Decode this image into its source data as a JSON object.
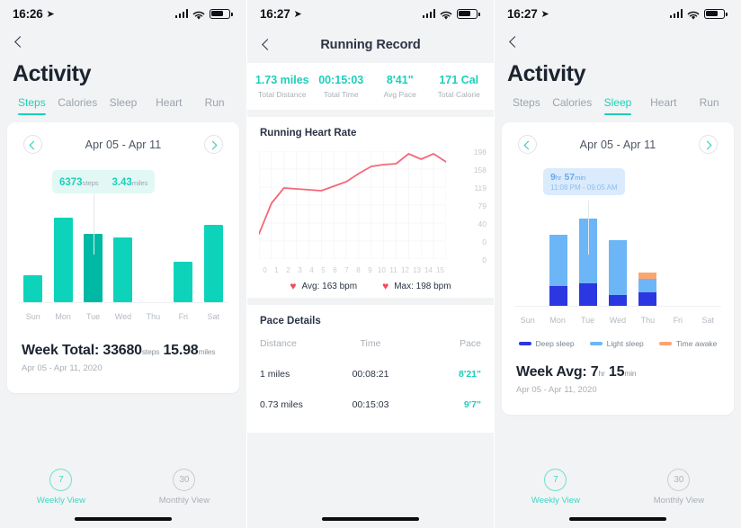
{
  "theme": {
    "accent_teal": "#1ecfbb",
    "bar_teal": "#0ed3bb",
    "bar_teal_highlight": "#00b9a5",
    "deep_sleep": "#2b37e0",
    "light_sleep": "#6cb6f7",
    "time_awake": "#fba570",
    "heart_red": "#f5495c",
    "page_bg": "#f2f3f4"
  },
  "panel_steps": {
    "status": {
      "time": "16:26",
      "location_icon": "location-arrow-icon",
      "signal_icon": "cellular-signal-icon",
      "wifi_icon": "wifi-icon",
      "battery_icon": "battery-icon"
    },
    "back_icon": "back-chevron-icon",
    "page_title": "Activity",
    "tabs": [
      {
        "label": "Steps",
        "active": true
      },
      {
        "label": "Calories",
        "active": false
      },
      {
        "label": "Sleep",
        "active": false
      },
      {
        "label": "Heart",
        "active": false
      },
      {
        "label": "Run",
        "active": false
      }
    ],
    "week_selector": {
      "prev_icon": "chevron-left-icon",
      "next_icon": "chevron-right-icon",
      "range": "Apr 05 - Apr 11"
    },
    "tooltip": {
      "steps_value": "6373",
      "steps_unit": "steps",
      "miles_value": "3.43",
      "miles_unit": "miles"
    },
    "summary": {
      "prefix": "Week Total:",
      "steps_value": "33680",
      "steps_unit": "steps",
      "miles_value": "15.98",
      "miles_unit": "miles",
      "date_range": "Apr 05 - Apr 11, 2020"
    },
    "bottom_nav": [
      {
        "badge": "7",
        "label": "Weekly View",
        "active": true
      },
      {
        "badge": "30",
        "label": "Monthly View",
        "active": false
      }
    ],
    "chart_data": {
      "type": "bar",
      "title": "Weekly Steps",
      "categories": [
        "Sun",
        "Mon",
        "Tue",
        "Wed",
        "Thu",
        "Fri",
        "Sat"
      ],
      "values": [
        2100,
        6600,
        5350,
        5050,
        0,
        3200,
        6050
      ],
      "highlight_index": 2,
      "ylabel": "steps",
      "xlabel": "",
      "grid": false,
      "legend": "none",
      "bar_pct": [
        30,
        93,
        75,
        71,
        0,
        45,
        85
      ]
    }
  },
  "panel_running": {
    "status": {
      "time": "16:27",
      "location_icon": "location-arrow-icon",
      "signal_icon": "cellular-signal-icon",
      "wifi_icon": "wifi-icon",
      "battery_icon": "battery-icon"
    },
    "back_icon": "back-chevron-icon",
    "nav_title": "Running Record",
    "stats": [
      {
        "value": "1.73 miles",
        "label": "Total Distance"
      },
      {
        "value": "00:15:03",
        "label": "Total Time"
      },
      {
        "value": "8'41\"",
        "label": "Avg Pace"
      },
      {
        "value": "171 Cal",
        "label": "Total Calorie"
      }
    ],
    "hr_section_title": "Running Heart Rate",
    "hr_legend": [
      {
        "icon": "heart-icon",
        "text": "Avg: 163 bpm"
      },
      {
        "icon": "heart-icon",
        "text": "Max: 198 bpm"
      }
    ],
    "pace_section_title": "Pace Details",
    "pace_headers": [
      "Distance",
      "Time",
      "Pace"
    ],
    "pace_rows": [
      {
        "distance": "1 miles",
        "time": "00:08:21",
        "pace": "8'21\""
      },
      {
        "distance": "0.73 miles",
        "time": "00:15:03",
        "pace": "9'7\""
      }
    ],
    "chart_data": {
      "type": "line",
      "title": "Running Heart Rate",
      "xlabel": "",
      "ylabel": "bpm",
      "x": [
        0,
        1,
        2,
        3,
        4,
        5,
        6,
        7,
        8,
        9,
        10,
        11,
        12,
        13,
        14,
        15
      ],
      "ytick_labels": [
        "198",
        "158",
        "119",
        "79",
        "40",
        "0",
        "0"
      ],
      "ylim": [
        0,
        240
      ],
      "grid": true,
      "legend": "below",
      "series": [
        {
          "name": "Heart Rate",
          "color": "#f5687a",
          "values": [
            57,
            125,
            143,
            142,
            141,
            139,
            145,
            152,
            165,
            178,
            180,
            181,
            198,
            190,
            198,
            183
          ]
        }
      ],
      "avg_bpm": 163,
      "max_bpm": 198
    }
  },
  "panel_sleep": {
    "status": {
      "time": "16:27",
      "location_icon": "location-arrow-icon",
      "signal_icon": "cellular-signal-icon",
      "wifi_icon": "wifi-icon",
      "battery_icon": "battery-icon"
    },
    "back_icon": "back-chevron-icon",
    "page_title": "Activity",
    "tabs": [
      {
        "label": "Steps",
        "active": false
      },
      {
        "label": "Calories",
        "active": false
      },
      {
        "label": "Sleep",
        "active": true
      },
      {
        "label": "Heart",
        "active": false
      },
      {
        "label": "Run",
        "active": false
      }
    ],
    "week_selector": {
      "prev_icon": "chevron-left-icon",
      "next_icon": "chevron-right-icon",
      "range": "Apr 05 - Apr 11"
    },
    "tooltip": {
      "hours": "9",
      "hr_unit": "hr",
      "minutes": "57",
      "min_unit": "min",
      "time_span": "11:08 PM - 09:05 AM"
    },
    "legend": [
      {
        "label": "Deep sleep",
        "color": "#2b37e0"
      },
      {
        "label": "Light sleep",
        "color": "#6cb6f7"
      },
      {
        "label": "Time awake",
        "color": "#fba570"
      }
    ],
    "summary": {
      "prefix": "Week Avg:",
      "hours": "7",
      "hr_unit": "hr",
      "minutes": "15",
      "min_unit": "min",
      "date_range": "Apr 05 - Apr 11, 2020"
    },
    "bottom_nav": [
      {
        "badge": "7",
        "label": "Weekly View",
        "active": true
      },
      {
        "badge": "30",
        "label": "Monthly View",
        "active": false
      }
    ],
    "chart_data": {
      "type": "bar",
      "stacked": true,
      "title": "Weekly Sleep",
      "categories": [
        "Sun",
        "Mon",
        "Tue",
        "Wed",
        "Thu",
        "Fri",
        "Sat"
      ],
      "ylabel": "hours",
      "grid": false,
      "legend": "below",
      "series": [
        {
          "name": "Deep sleep",
          "color": "#2b37e0",
          "values_pct": [
            0,
            22,
            25,
            12,
            15,
            0,
            0
          ]
        },
        {
          "name": "Light sleep",
          "color": "#6cb6f7",
          "values_pct": [
            0,
            58,
            73,
            62,
            15,
            0,
            0
          ]
        },
        {
          "name": "Time awake",
          "color": "#fba570",
          "values_pct": [
            0,
            0,
            0,
            0,
            7,
            0,
            0
          ]
        }
      ],
      "highlight_index": 2
    }
  }
}
